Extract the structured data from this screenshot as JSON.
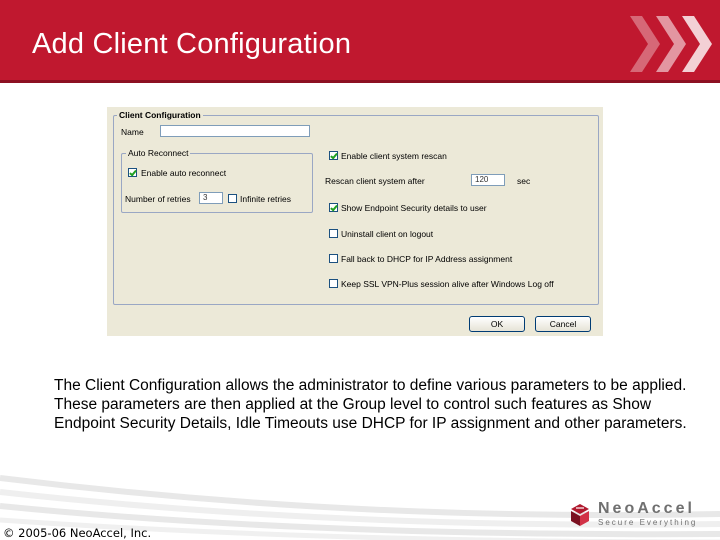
{
  "slide": {
    "title": "Add Client Configuration",
    "body": "The Client Configuration allows the administrator to define various parameters to be applied. These parameters are then applied at the Group level to control such features as Show Endpoint Security Details, Idle Timeouts use DHCP for IP assignment and other parameters.",
    "copyright": "© 2005-06 NeoAccel, Inc.",
    "logo_name": "NeoAccel",
    "logo_tagline": "Secure Everything"
  },
  "dialog": {
    "group_title": "Client Configuration",
    "name_label": "Name",
    "name_value": "",
    "auto_reconnect": {
      "title": "Auto Reconnect",
      "enable_label": "Enable auto reconnect",
      "enable_checked": true,
      "retries_label": "Number of retries",
      "retries_value": "3",
      "infinite_label": "Infinite retries",
      "infinite_checked": false
    },
    "options": {
      "enable_rescan_label": "Enable client system rescan",
      "enable_rescan_checked": true,
      "rescan_after_label": "Rescan client system after",
      "rescan_value": "120",
      "rescan_unit": "sec",
      "show_endpoint_label": "Show Endpoint Security details to user",
      "show_endpoint_checked": true,
      "uninstall_label": "Uninstall client on logout",
      "uninstall_checked": false,
      "dhcp_label": "Fall back to DHCP for IP Address assignment",
      "dhcp_checked": false,
      "keep_alive_label": "Keep SSL VPN-Plus session alive after Windows Log off",
      "keep_alive_checked": false
    },
    "ok_label": "OK",
    "cancel_label": "Cancel"
  },
  "colors": {
    "header_red": "#c0182f",
    "dialog_bg": "#ece9d8",
    "fieldset_border": "#9aa7c4"
  }
}
